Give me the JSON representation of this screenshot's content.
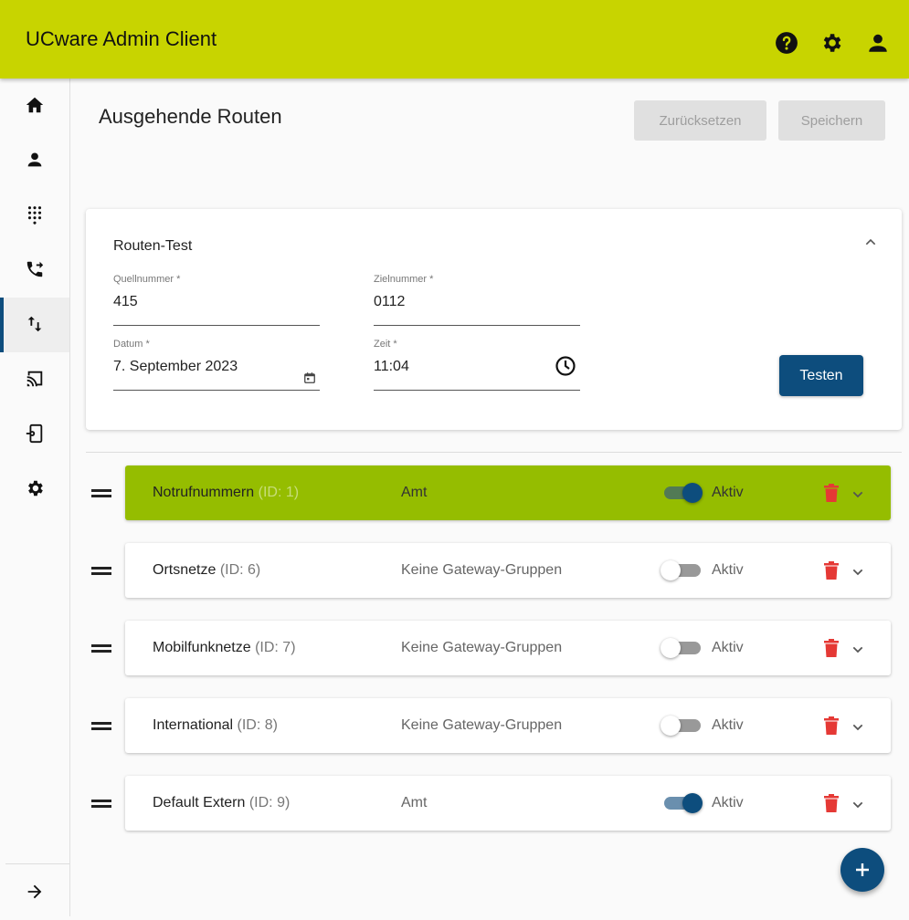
{
  "app": {
    "title": "UCware Admin Client"
  },
  "header_icons": [
    "help-icon",
    "settings-icon",
    "user-icon"
  ],
  "sidebar": {
    "items": [
      {
        "name": "home",
        "icon": "home-icon"
      },
      {
        "name": "users",
        "icon": "person-icon"
      },
      {
        "name": "dialpad",
        "icon": "dialpad-icon"
      },
      {
        "name": "call-forward",
        "icon": "phone-forward-icon"
      },
      {
        "name": "routes",
        "icon": "swap-vert-icon",
        "active": true
      },
      {
        "name": "cast",
        "icon": "cast-icon"
      },
      {
        "name": "device-settings",
        "icon": "phonelink-setup-icon"
      },
      {
        "name": "settings",
        "icon": "gear-icon"
      }
    ],
    "expand_icon": "arrow-right-icon"
  },
  "page": {
    "title": "Ausgehende Routen",
    "reset_label": "Zurücksetzen",
    "save_label": "Speichern"
  },
  "route_test": {
    "title": "Routen-Test",
    "source_label": "Quellnummer *",
    "source_value": "415",
    "target_label": "Zielnummer *",
    "target_value": "0112",
    "date_label": "Datum *",
    "date_value": "7. September 2023",
    "time_label": "Zeit *",
    "time_value": "11:04",
    "test_label": "Testen"
  },
  "routes": [
    {
      "name": "Notrufnummern",
      "id": "(ID: 1)",
      "gateway": "Amt",
      "active": true,
      "status_label": "Aktiv",
      "highlighted": true
    },
    {
      "name": "Ortsnetze",
      "id": "(ID: 6)",
      "gateway": "Keine Gateway-Gruppen",
      "active": false,
      "status_label": "Aktiv"
    },
    {
      "name": "Mobilfunknetze",
      "id": "(ID: 7)",
      "gateway": "Keine Gateway-Gruppen",
      "active": false,
      "status_label": "Aktiv"
    },
    {
      "name": "International",
      "id": "(ID: 8)",
      "gateway": "Keine Gateway-Gruppen",
      "active": false,
      "status_label": "Aktiv"
    },
    {
      "name": "Default Extern",
      "id": "(ID: 9)",
      "gateway": "Amt",
      "active": true,
      "status_label": "Aktiv"
    }
  ],
  "colors": {
    "topbar": "#c8d400",
    "primary": "#0d4d7d",
    "highlight_row": "#95bd00",
    "delete": "#e53935"
  }
}
